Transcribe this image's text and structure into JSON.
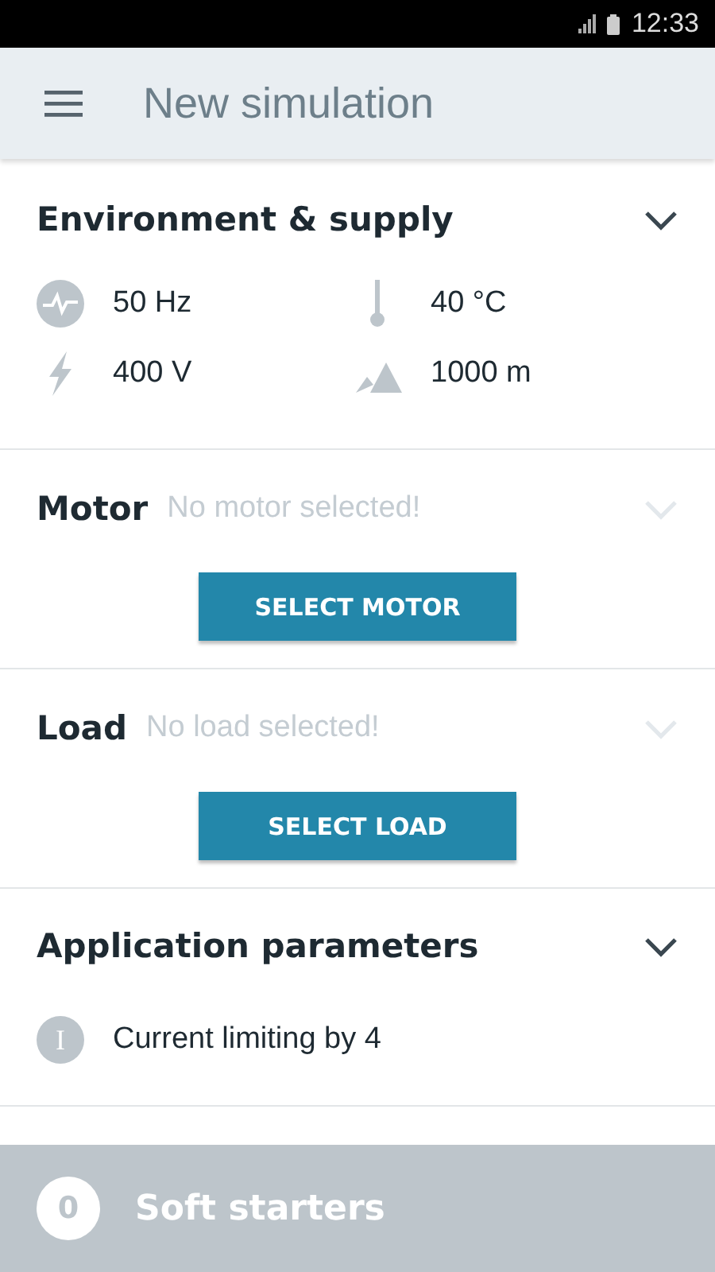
{
  "status_bar": {
    "time": "12:33"
  },
  "app_bar": {
    "title": "New simulation"
  },
  "sections": [
    {
      "kind": "params",
      "title": "Environment & supply",
      "enabled": true,
      "params": [
        {
          "value": "50 Hz"
        },
        {
          "value": "40 °C"
        },
        {
          "value": "400 V"
        },
        {
          "value": "1000 m"
        }
      ]
    },
    {
      "kind": "select",
      "title": "Motor",
      "status": "No motor selected!",
      "enabled": false,
      "button": "SELECT MOTOR"
    },
    {
      "kind": "select",
      "title": "Load",
      "status": "No load selected!",
      "enabled": false,
      "button": "SELECT LOAD"
    },
    {
      "kind": "list",
      "title": "Application parameters",
      "enabled": true,
      "items": [
        {
          "badge": "I",
          "text": "Current limiting by 4"
        }
      ]
    }
  ],
  "bottom_bar": {
    "count": "0",
    "label": "Soft starters"
  }
}
